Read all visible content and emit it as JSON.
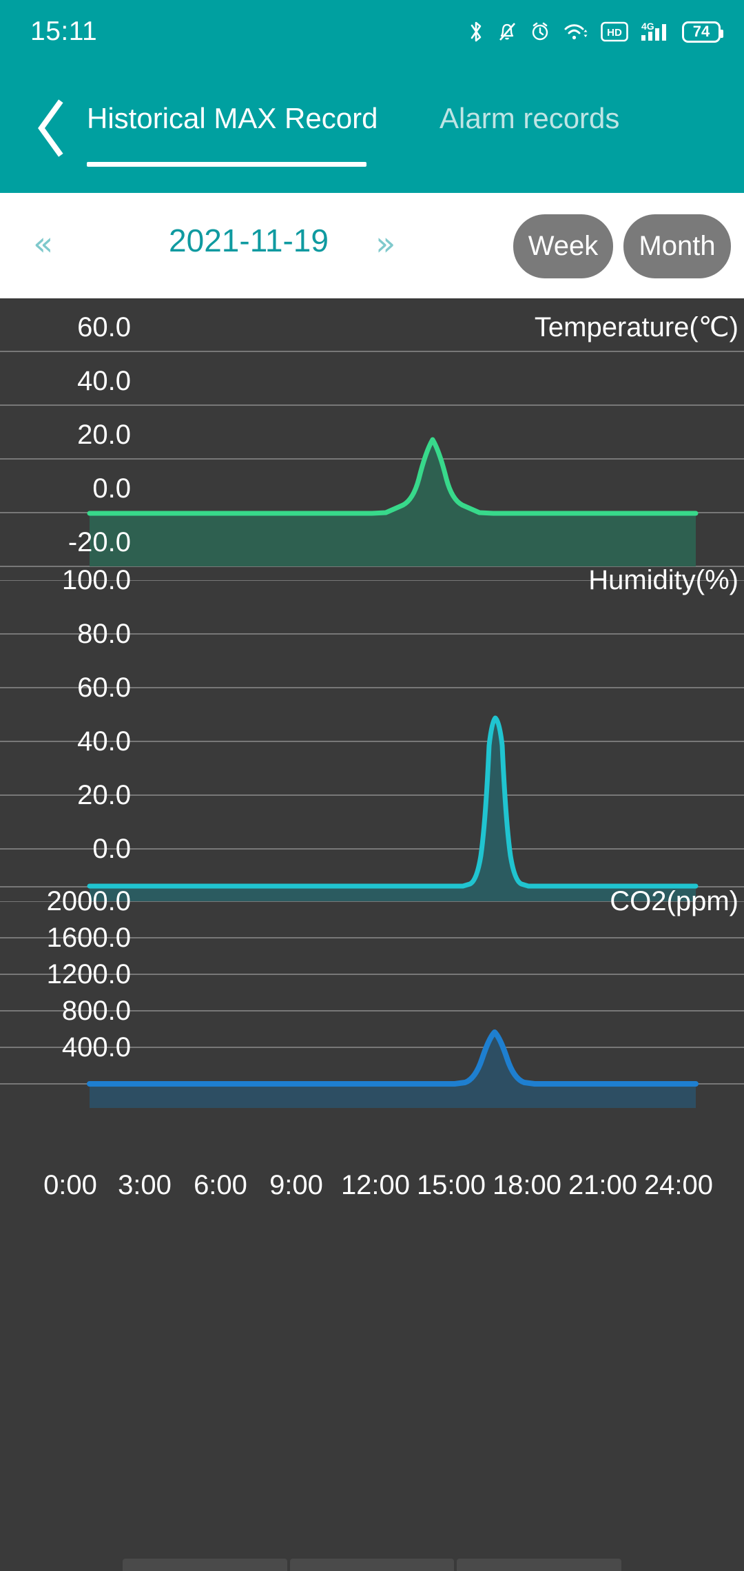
{
  "status_bar": {
    "time": "15:11",
    "battery_level": "74",
    "icons": [
      "bluetooth-icon",
      "bell-muted-icon",
      "alarm-clock-icon",
      "wifi-icon",
      "hd-icon",
      "signal-4g-icon",
      "battery-icon"
    ]
  },
  "app_bar": {
    "back_icon": "back-chevron-icon",
    "tabs": [
      {
        "label": "Historical MAX Record",
        "active": true
      },
      {
        "label": "Alarm records",
        "active": false
      }
    ]
  },
  "date_bar": {
    "prev_icon": "double-chevron-left-icon",
    "next_icon": "double-chevron-right-icon",
    "date": "2021-11-19",
    "week_label": "Week",
    "month_label": "Month",
    "accent_color": "#0f9aa0",
    "pill_color": "#7a7a7a"
  },
  "theme": {
    "header_teal": "#00a0a0",
    "chart_bg": "#3a3a3a",
    "gridline": "#787878",
    "text": "#ffffff"
  },
  "chart_data": [
    {
      "type": "line",
      "title": "Temperature(℃)",
      "ylabel": "Temperature(℃)",
      "xlabel": "",
      "ytick_labels": [
        "60.0",
        "40.0",
        "20.0",
        "0.0",
        "-20.0"
      ],
      "ytick_values": [
        60,
        40,
        20,
        0,
        -20
      ],
      "ylim": [
        -30,
        60
      ],
      "xlim": [
        0,
        24
      ],
      "xtick_labels": [
        "0:00",
        "3:00",
        "6:00",
        "9:00",
        "12:00",
        "15:00",
        "18:00",
        "21:00",
        "24:00"
      ],
      "grid": true,
      "legend": "none",
      "line_color": "#38d98b",
      "fill_color": "#2e6050",
      "baseline_value": -5,
      "peak_time": "16:00",
      "peak_value": 20.4,
      "x": [
        0,
        1,
        2,
        3,
        4,
        5,
        6,
        7,
        8,
        9,
        10,
        11,
        12,
        13,
        14,
        14.6,
        15.2,
        15.6,
        16,
        16.4,
        16.8,
        17.4,
        18,
        19,
        20,
        21,
        22,
        23,
        24
      ],
      "values": [
        -5,
        -5,
        -5,
        -5,
        -5,
        -5,
        -5,
        -5,
        -5,
        -5,
        -5,
        -5,
        -5,
        -5,
        -5,
        -4.2,
        3.5,
        13.5,
        20.4,
        13.5,
        3.5,
        -4.2,
        -5,
        -5,
        -5,
        -5,
        -5,
        -5,
        -5
      ]
    },
    {
      "type": "line",
      "title": "Humidity(%)",
      "ylabel": "Humidity(%)",
      "xlabel": "",
      "ytick_labels": [
        "100.0",
        "80.0",
        "60.0",
        "40.0",
        "20.0",
        "0.0"
      ],
      "ytick_values": [
        100,
        80,
        60,
        40,
        20,
        0
      ],
      "ylim": [
        -8,
        100
      ],
      "xlim": [
        0,
        24
      ],
      "xtick_labels": [
        "0:00",
        "3:00",
        "6:00",
        "9:00",
        "12:00",
        "15:00",
        "18:00",
        "21:00",
        "24:00"
      ],
      "grid": true,
      "legend": "none",
      "line_color": "#20c4d0",
      "fill_color": "#2b5b60",
      "baseline_value": -5,
      "peak_time": "16:00",
      "peak_value": 45.5,
      "x": [
        0,
        1,
        2,
        3,
        4,
        5,
        6,
        7,
        8,
        9,
        10,
        11,
        12,
        13,
        14,
        14.8,
        15.3,
        15.7,
        16,
        16.3,
        16.7,
        17.2,
        18,
        19,
        20,
        21,
        22,
        23,
        24
      ],
      "values": [
        -5,
        -5,
        -5,
        -5,
        -5,
        -5,
        -5,
        -5,
        -5,
        -5,
        -5,
        -5,
        -5,
        -5,
        -5,
        -4,
        10,
        33,
        45.5,
        33,
        10,
        -4,
        -5,
        -5,
        -5,
        -5,
        -5,
        -5,
        -5
      ]
    },
    {
      "type": "line",
      "title": "CO2(ppm)",
      "ylabel": "CO2(ppm)",
      "xlabel": "",
      "ytick_labels": [
        "2000.0",
        "1600.0",
        "1200.0",
        "800.0",
        "400.0"
      ],
      "ytick_values": [
        2000,
        1600,
        1200,
        800,
        400
      ],
      "ylim": [
        290,
        2000
      ],
      "xlim": [
        0,
        24
      ],
      "xtick_labels": [
        "0:00",
        "3:00",
        "6:00",
        "9:00",
        "12:00",
        "15:00",
        "18:00",
        "21:00",
        "24:00"
      ],
      "grid": true,
      "legend": "none",
      "line_color": "#1e7fd0",
      "fill_color": "#2d4e63",
      "baseline_value": 340,
      "peak_time": "16:00",
      "peak_value": 700,
      "x": [
        0,
        1,
        2,
        3,
        4,
        5,
        6,
        7,
        8,
        9,
        10,
        11,
        12,
        13,
        14,
        14.6,
        15.2,
        15.6,
        16,
        16.4,
        16.8,
        17.4,
        18,
        19,
        20,
        21,
        22,
        23,
        24
      ],
      "values": [
        340,
        340,
        340,
        340,
        340,
        340,
        340,
        340,
        340,
        340,
        340,
        340,
        340,
        340,
        340,
        350,
        430,
        600,
        700,
        600,
        430,
        350,
        340,
        340,
        340,
        340,
        340,
        340,
        340
      ]
    }
  ],
  "x_axis": {
    "ticks": [
      "0:00",
      "3:00",
      "6:00",
      "9:00",
      "12:00",
      "15:00",
      "18:00",
      "21:00",
      "24:00"
    ]
  }
}
